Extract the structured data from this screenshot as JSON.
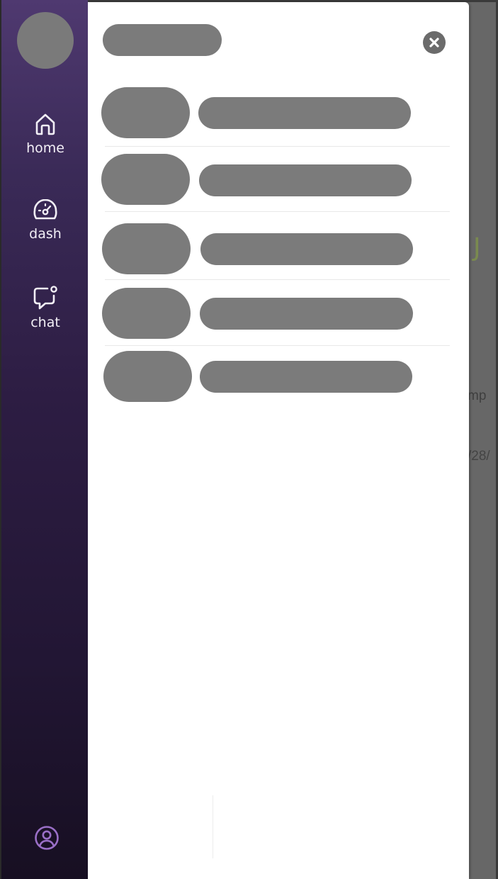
{
  "background_page": {
    "partial_text_1": "mp",
    "partial_text_2": "/28/",
    "partial_glyph": "J"
  },
  "nav_rail": {
    "items": [
      {
        "label": "home",
        "icon": "home-icon"
      },
      {
        "label": "dash",
        "icon": "dashboard-gauge-icon"
      },
      {
        "label": "chat",
        "icon": "chat-notification-icon"
      }
    ],
    "footer_icon": "user-profile-icon",
    "colors": {
      "gradient_top": "#4f3970",
      "gradient_bottom": "#170f22",
      "label": "#f2eff6",
      "profile_icon": "#9a6fc7"
    }
  },
  "drawer": {
    "close_icon": "close-circle-icon",
    "loading_placeholder_color": "#7b7b7b",
    "skeleton_rows": 5
  }
}
